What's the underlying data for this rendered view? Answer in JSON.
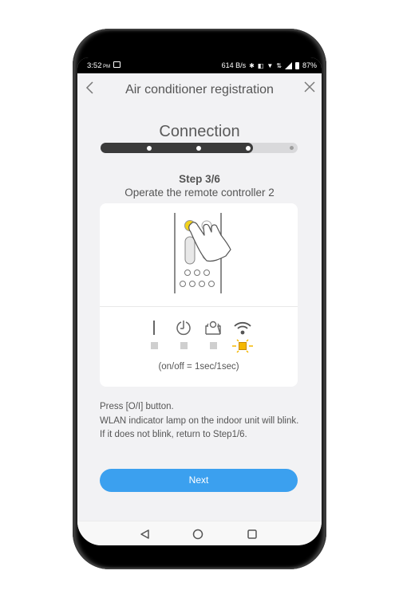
{
  "status_bar": {
    "time": "3:52",
    "ampm": "PM",
    "network_speed": "614 B/s",
    "battery": "87%",
    "icons": [
      "image-notification-icon",
      "bluetooth-icon",
      "vibrate-icon",
      "wifi-icon",
      "data-icon",
      "signal-icon",
      "battery-icon"
    ]
  },
  "header": {
    "title": "Air conditioner registration",
    "back_icon": "chevron-left-icon",
    "close_icon": "close-icon"
  },
  "section": {
    "title": "Connection",
    "progress": {
      "completed_steps": 3,
      "total_steps": 4
    }
  },
  "step": {
    "number": "Step 3/6",
    "description": "Operate the remote controller 2"
  },
  "card": {
    "illustration": "hand-pressing-remote-button",
    "highlight_color": "#f2d21b",
    "indicators": [
      {
        "icon": "power-icon",
        "state": "off"
      },
      {
        "icon": "timer-icon",
        "state": "off"
      },
      {
        "icon": "filter-icon",
        "state": "off"
      },
      {
        "icon": "wlan-icon",
        "state": "blinking"
      }
    ],
    "blink_color": "#f5b800",
    "caption": "(on/off = 1sec/1sec)"
  },
  "instructions": [
    "Press [O/I] button.",
    "WLAN indicator lamp on the indoor unit will blink.",
    "If it does not blink, return to Step1/6."
  ],
  "next_button": {
    "label": "Next",
    "color": "#3ba0ef"
  },
  "nav_bar": {
    "items": [
      "back",
      "home",
      "recents"
    ]
  }
}
